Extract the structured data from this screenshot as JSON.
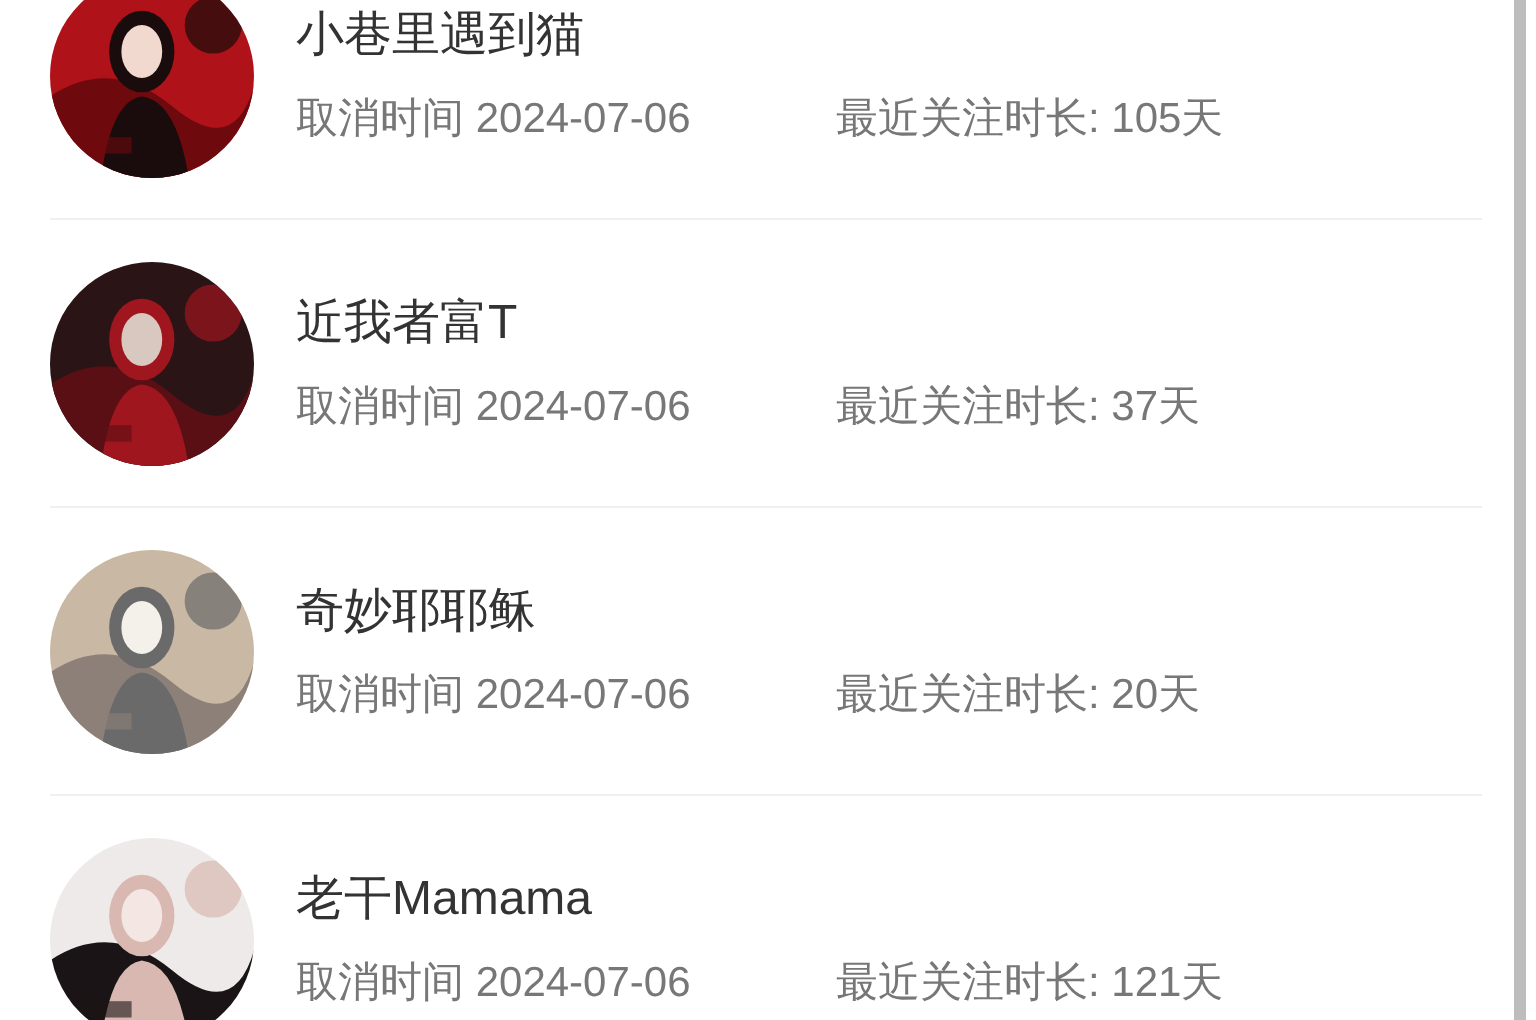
{
  "users": [
    {
      "name": "小巷里遇到猫",
      "cancel_time": "取消时间 2024-07-06",
      "follow_duration": "最近关注时长: 105天"
    },
    {
      "name": "近我者富T",
      "cancel_time": "取消时间 2024-07-06",
      "follow_duration": "最近关注时长: 37天"
    },
    {
      "name": "奇妙耶耶稣",
      "cancel_time": "取消时间 2024-07-06",
      "follow_duration": "最近关注时长: 20天"
    },
    {
      "name": "老干Mamama",
      "cancel_time": "取消时间 2024-07-06",
      "follow_duration": "最近关注时长: 121天"
    }
  ]
}
